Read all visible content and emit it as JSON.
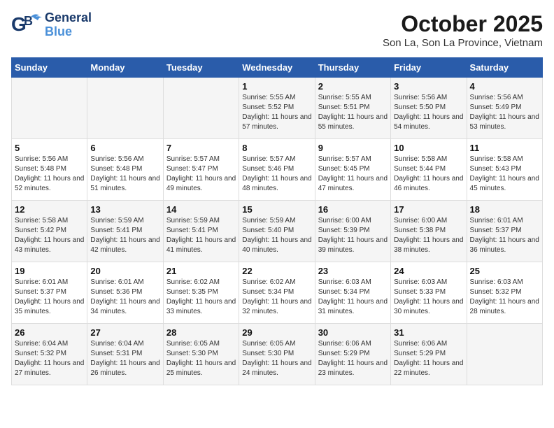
{
  "logo": {
    "line1": "General",
    "line2": "Blue"
  },
  "title": "October 2025",
  "subtitle": "Son La, Son La Province, Vietnam",
  "days_header": [
    "Sunday",
    "Monday",
    "Tuesday",
    "Wednesday",
    "Thursday",
    "Friday",
    "Saturday"
  ],
  "weeks": [
    [
      {
        "day": "",
        "info": ""
      },
      {
        "day": "",
        "info": ""
      },
      {
        "day": "",
        "info": ""
      },
      {
        "day": "1",
        "info": "Sunrise: 5:55 AM\nSunset: 5:52 PM\nDaylight: 11 hours and 57 minutes."
      },
      {
        "day": "2",
        "info": "Sunrise: 5:55 AM\nSunset: 5:51 PM\nDaylight: 11 hours and 55 minutes."
      },
      {
        "day": "3",
        "info": "Sunrise: 5:56 AM\nSunset: 5:50 PM\nDaylight: 11 hours and 54 minutes."
      },
      {
        "day": "4",
        "info": "Sunrise: 5:56 AM\nSunset: 5:49 PM\nDaylight: 11 hours and 53 minutes."
      }
    ],
    [
      {
        "day": "5",
        "info": "Sunrise: 5:56 AM\nSunset: 5:48 PM\nDaylight: 11 hours and 52 minutes."
      },
      {
        "day": "6",
        "info": "Sunrise: 5:56 AM\nSunset: 5:48 PM\nDaylight: 11 hours and 51 minutes."
      },
      {
        "day": "7",
        "info": "Sunrise: 5:57 AM\nSunset: 5:47 PM\nDaylight: 11 hours and 49 minutes."
      },
      {
        "day": "8",
        "info": "Sunrise: 5:57 AM\nSunset: 5:46 PM\nDaylight: 11 hours and 48 minutes."
      },
      {
        "day": "9",
        "info": "Sunrise: 5:57 AM\nSunset: 5:45 PM\nDaylight: 11 hours and 47 minutes."
      },
      {
        "day": "10",
        "info": "Sunrise: 5:58 AM\nSunset: 5:44 PM\nDaylight: 11 hours and 46 minutes."
      },
      {
        "day": "11",
        "info": "Sunrise: 5:58 AM\nSunset: 5:43 PM\nDaylight: 11 hours and 45 minutes."
      }
    ],
    [
      {
        "day": "12",
        "info": "Sunrise: 5:58 AM\nSunset: 5:42 PM\nDaylight: 11 hours and 43 minutes."
      },
      {
        "day": "13",
        "info": "Sunrise: 5:59 AM\nSunset: 5:41 PM\nDaylight: 11 hours and 42 minutes."
      },
      {
        "day": "14",
        "info": "Sunrise: 5:59 AM\nSunset: 5:41 PM\nDaylight: 11 hours and 41 minutes."
      },
      {
        "day": "15",
        "info": "Sunrise: 5:59 AM\nSunset: 5:40 PM\nDaylight: 11 hours and 40 minutes."
      },
      {
        "day": "16",
        "info": "Sunrise: 6:00 AM\nSunset: 5:39 PM\nDaylight: 11 hours and 39 minutes."
      },
      {
        "day": "17",
        "info": "Sunrise: 6:00 AM\nSunset: 5:38 PM\nDaylight: 11 hours and 38 minutes."
      },
      {
        "day": "18",
        "info": "Sunrise: 6:01 AM\nSunset: 5:37 PM\nDaylight: 11 hours and 36 minutes."
      }
    ],
    [
      {
        "day": "19",
        "info": "Sunrise: 6:01 AM\nSunset: 5:37 PM\nDaylight: 11 hours and 35 minutes."
      },
      {
        "day": "20",
        "info": "Sunrise: 6:01 AM\nSunset: 5:36 PM\nDaylight: 11 hours and 34 minutes."
      },
      {
        "day": "21",
        "info": "Sunrise: 6:02 AM\nSunset: 5:35 PM\nDaylight: 11 hours and 33 minutes."
      },
      {
        "day": "22",
        "info": "Sunrise: 6:02 AM\nSunset: 5:34 PM\nDaylight: 11 hours and 32 minutes."
      },
      {
        "day": "23",
        "info": "Sunrise: 6:03 AM\nSunset: 5:34 PM\nDaylight: 11 hours and 31 minutes."
      },
      {
        "day": "24",
        "info": "Sunrise: 6:03 AM\nSunset: 5:33 PM\nDaylight: 11 hours and 30 minutes."
      },
      {
        "day": "25",
        "info": "Sunrise: 6:03 AM\nSunset: 5:32 PM\nDaylight: 11 hours and 28 minutes."
      }
    ],
    [
      {
        "day": "26",
        "info": "Sunrise: 6:04 AM\nSunset: 5:32 PM\nDaylight: 11 hours and 27 minutes."
      },
      {
        "day": "27",
        "info": "Sunrise: 6:04 AM\nSunset: 5:31 PM\nDaylight: 11 hours and 26 minutes."
      },
      {
        "day": "28",
        "info": "Sunrise: 6:05 AM\nSunset: 5:30 PM\nDaylight: 11 hours and 25 minutes."
      },
      {
        "day": "29",
        "info": "Sunrise: 6:05 AM\nSunset: 5:30 PM\nDaylight: 11 hours and 24 minutes."
      },
      {
        "day": "30",
        "info": "Sunrise: 6:06 AM\nSunset: 5:29 PM\nDaylight: 11 hours and 23 minutes."
      },
      {
        "day": "31",
        "info": "Sunrise: 6:06 AM\nSunset: 5:29 PM\nDaylight: 11 hours and 22 minutes."
      },
      {
        "day": "",
        "info": ""
      }
    ]
  ]
}
